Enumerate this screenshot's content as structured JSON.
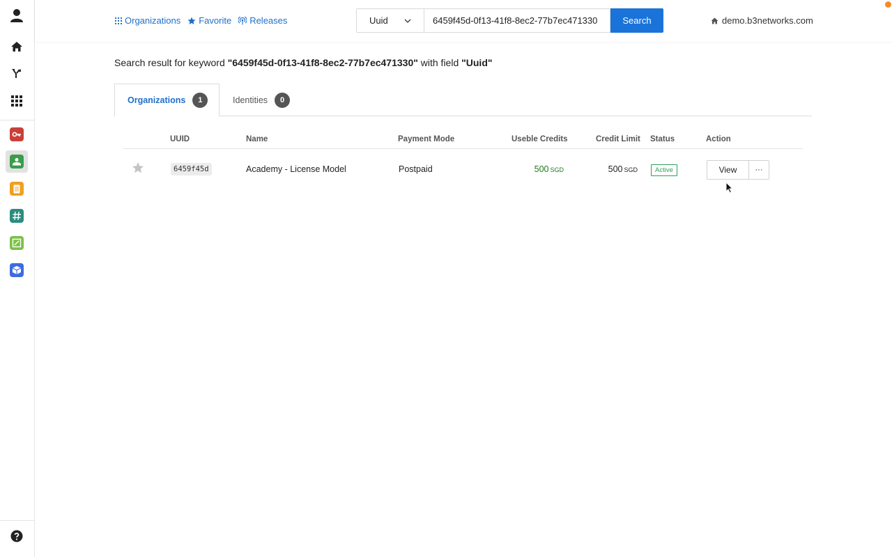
{
  "nav": {
    "organizations": "Organizations",
    "favorite": "Favorite",
    "releases": "Releases"
  },
  "search": {
    "field": "Uuid",
    "value": "6459f45d-0f13-41f8-8ec2-77b7ec471330",
    "button": "Search"
  },
  "domain": "demo.b3networks.com",
  "result": {
    "prefix": "Search result for keyword ",
    "keyword": "\"6459f45d-0f13-41f8-8ec2-77b7ec471330\"",
    "middle": " with field ",
    "field": "\"Uuid\""
  },
  "tabs": [
    {
      "label": "Organizations",
      "count": "1"
    },
    {
      "label": "Identities",
      "count": "0"
    }
  ],
  "table": {
    "headers": [
      "UUID",
      "Name",
      "Payment Mode",
      "Useble Credits",
      "Credit Limit",
      "Status",
      "Action"
    ],
    "rows": [
      {
        "uuid": "6459f45d",
        "name": "Academy - License Model",
        "payment_mode": "Postpaid",
        "usable_credits": "500",
        "usable_unit": "SGD",
        "credit_limit": "500",
        "credit_unit": "SGD",
        "status": "Active",
        "view_label": "View",
        "more_label": "···"
      }
    ]
  },
  "colors": {
    "accent": "#1a73d9",
    "link": "#1f6fc9",
    "active_status": "#2e9e5b",
    "credit": "#1a7a1a"
  },
  "sidebar_icons": [
    "user-icon",
    "home-icon",
    "branch-icon",
    "apps-grid-icon",
    "key-app-icon",
    "org-app-icon",
    "notes-app-icon",
    "hash-app-icon",
    "board-app-icon",
    "box-app-icon",
    "help-icon"
  ]
}
